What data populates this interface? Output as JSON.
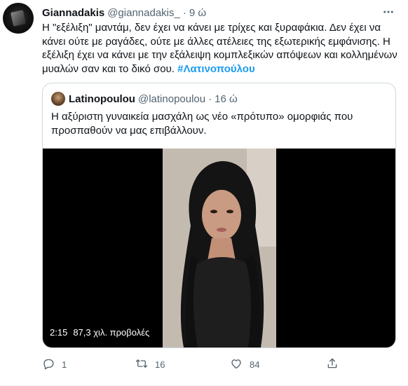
{
  "tweet": {
    "author_name": "Giannadakis",
    "author_handle": "@giannadakis_",
    "separator": "·",
    "time": "9 ώ",
    "text_main": "Η \"εξέλιξη\" μαντάμ, δεν έχει να κάνει με τρίχες και ξυραφάκια. Δεν έχει να κάνει ούτε με ραγάδες, ούτε με άλλες ατέλειες της εξωτερικής εμφάνισης. Η εξέλιξη έχει να κάνει με την εξάλειψη κομπλεξικών απόψεων και κολλημένων μυαλών σαν και το δικό σου.",
    "hashtag": "#Λατινοπούλου"
  },
  "quoted": {
    "author_name": "Latinopoulou",
    "author_handle": "@latinopoulou",
    "separator": "·",
    "time": "16 ώ",
    "text": "Η αξύριστη γυναικεία μασχάλη ως νέο «πρότυπο» ομορφιάς που προσπαθούν να μας επιβάλλουν.",
    "video": {
      "duration": "2:15",
      "views": "87,3 χιλ. προβολές"
    }
  },
  "actions": {
    "reply_count": "1",
    "retweet_count": "16",
    "like_count": "84",
    "share_label": ""
  },
  "icons": {
    "more": "more-horizontal-icon",
    "reply": "reply-icon",
    "retweet": "retweet-icon",
    "like": "heart-icon",
    "share": "share-icon"
  },
  "colors": {
    "accent": "#1d9bf0",
    "text": "#0f1419",
    "muted": "#536471",
    "border": "#cfd9de"
  }
}
